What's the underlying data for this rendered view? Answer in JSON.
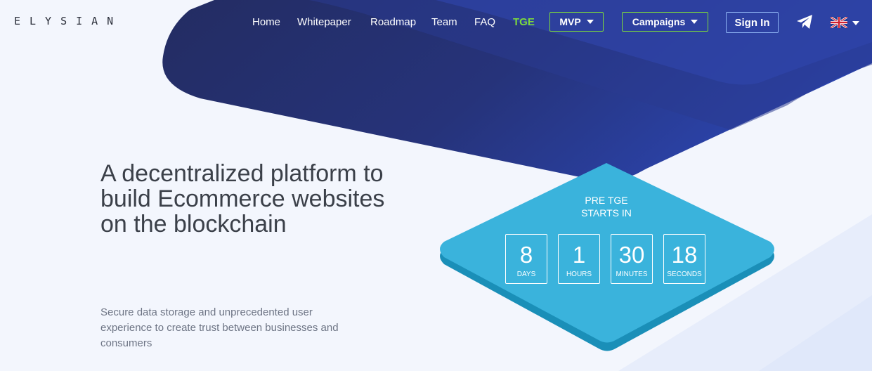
{
  "brand": {
    "logo": "ELYSIAN"
  },
  "nav": {
    "links": [
      "Home",
      "Whitepaper",
      "Roadmap",
      "Team",
      "FAQ",
      "TGE"
    ],
    "buttons": {
      "mvp": "MVP",
      "campaigns": "Campaigns",
      "signin": "Sign In"
    },
    "icons": [
      "telegram-icon",
      "uk-flag-icon",
      "chevron-down-icon"
    ],
    "accent_color": "#7cd93c"
  },
  "hero": {
    "title": "A decentralized platform to build Ecommerce websites on the blockchain",
    "subtitle": "Secure data storage and unprecedented user experience to create trust between businesses and consumers"
  },
  "countdown": {
    "line1": "PRE TGE",
    "line2": "STARTS IN",
    "units": [
      {
        "value": "8",
        "label": "DAYS"
      },
      {
        "value": "1",
        "label": "HOURS"
      },
      {
        "value": "30",
        "label": "MINUTES"
      },
      {
        "value": "18",
        "label": "SECONDS"
      }
    ],
    "color": "#3ab3dc"
  },
  "colors": {
    "navy": "#232f6e",
    "blue": "#2a45a8",
    "background": "#f3f6fd"
  }
}
